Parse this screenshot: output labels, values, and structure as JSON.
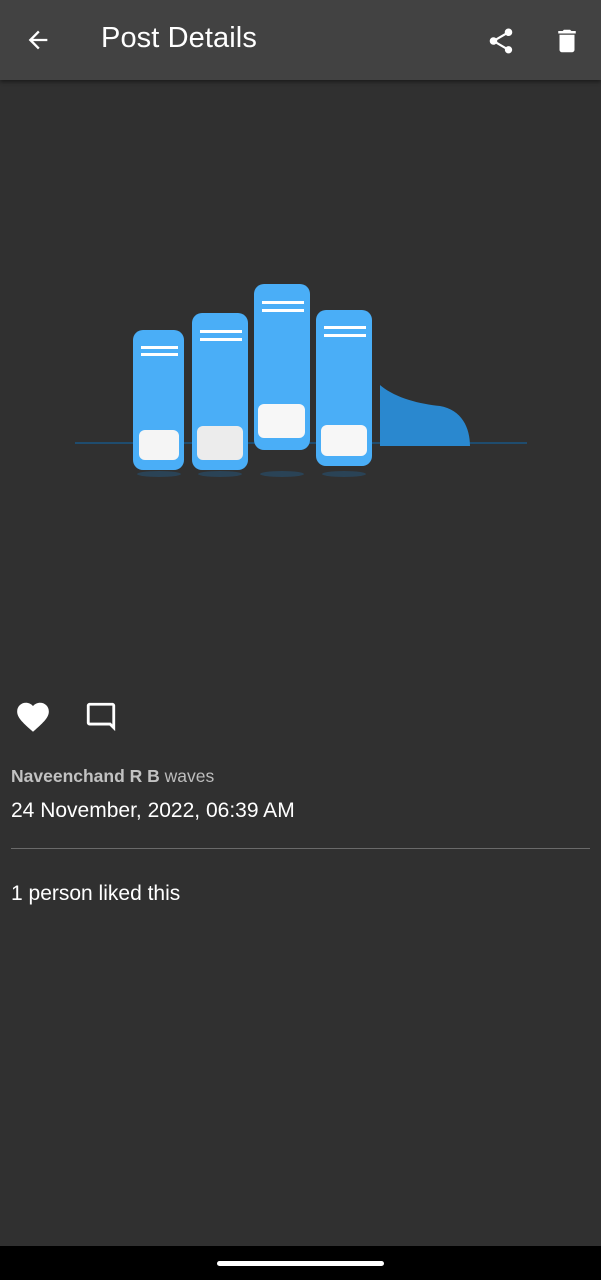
{
  "appbar": {
    "title": "Post Details",
    "back_icon": "arrow-back-icon",
    "share_icon": "share-icon",
    "delete_icon": "delete-icon"
  },
  "post": {
    "image_icon": "books-illustration",
    "author": "Naveenchand R B",
    "caption_text": "waves",
    "timestamp": "24 November, 2022, 06:39 AM",
    "likes_summary": "1 person liked this"
  },
  "actions": {
    "like_icon": "heart-icon",
    "comment_icon": "comment-icon"
  },
  "colors": {
    "background": "#303030",
    "appbar": "#424242",
    "book_blue": "#4aaef7",
    "book_dark_blue": "#2a88cf",
    "text_primary": "#ffffff",
    "text_secondary": "#bdbdbd",
    "divider": "#6a6a6a"
  }
}
